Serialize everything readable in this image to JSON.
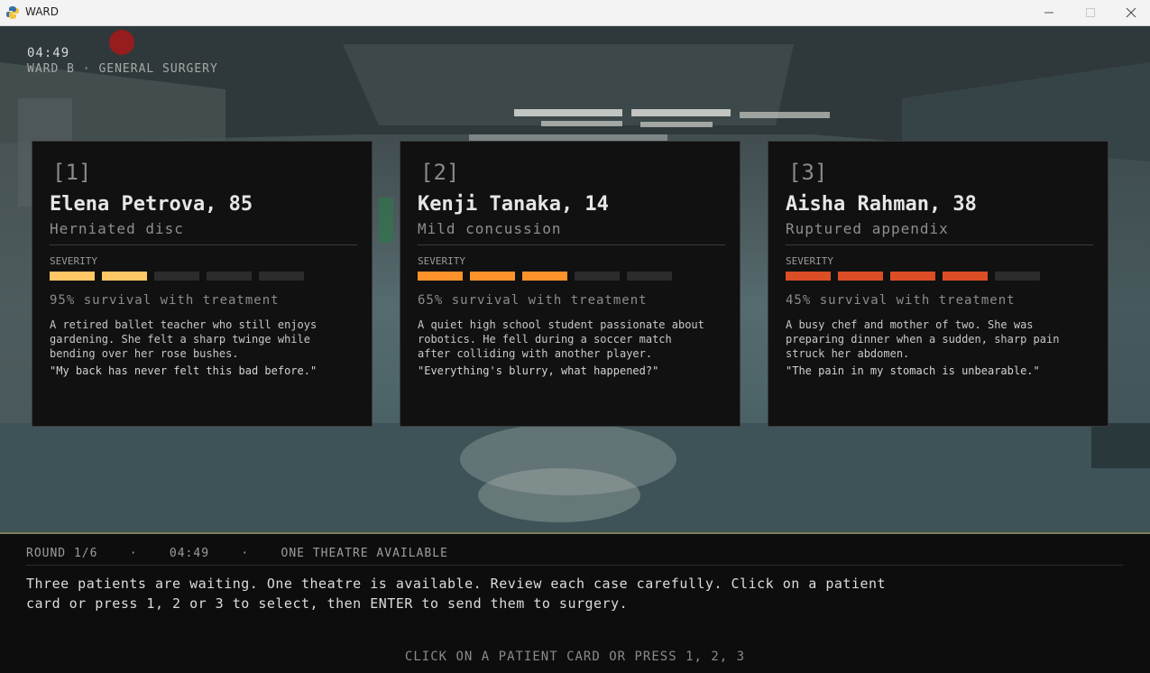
{
  "window": {
    "title": "WARD"
  },
  "hud": {
    "time": "04:49",
    "ward": "WARD B · GENERAL SURGERY"
  },
  "colors": {
    "severity_1": "#ffc766",
    "severity_2": "#ff922b",
    "severity_3": "#dc4e26",
    "severity_off": "#2c2c2c"
  },
  "cards": [
    {
      "number": "[1]",
      "name": "Elena Petrova, 85",
      "condition": "Herniated disc",
      "severity_label": "SEVERITY",
      "severity": 2,
      "severity_max": 5,
      "survival": "95% survival with treatment",
      "description": "A retired ballet teacher who still enjoys\ngardening. She felt a sharp twinge while\nbending over her rose bushes.",
      "quote": "\"My back has never felt this bad before.\""
    },
    {
      "number": "[2]",
      "name": "Kenji Tanaka, 14",
      "condition": "Mild concussion",
      "severity_label": "SEVERITY",
      "severity": 3,
      "severity_max": 5,
      "survival": "65% survival with treatment",
      "description": "A quiet high school student passionate about\nrobotics. He fell during a soccer match\nafter colliding with another player.",
      "quote": "\"Everything's blurry, what happened?\""
    },
    {
      "number": "[3]",
      "name": "Aisha Rahman, 38",
      "condition": "Ruptured appendix",
      "severity_label": "SEVERITY",
      "severity": 4,
      "severity_max": 5,
      "survival": "45% survival with treatment",
      "description": "A busy chef and mother of two. She was\npreparing dinner when a sudden, sharp pain\nstruck her abdomen.",
      "quote": "\"The pain in my stomach is unbearable.\""
    }
  ],
  "status": {
    "round": "ROUND 1/6",
    "separator": "·",
    "time": "04:49",
    "theatre": "ONE THEATRE AVAILABLE"
  },
  "message": "Three patients are waiting. One theatre is available. Review each case carefully. Click on a patient\ncard or press 1, 2 or 3 to select, then ENTER to send them to surgery.",
  "prompt": "CLICK ON A PATIENT CARD OR PRESS 1, 2, 3"
}
